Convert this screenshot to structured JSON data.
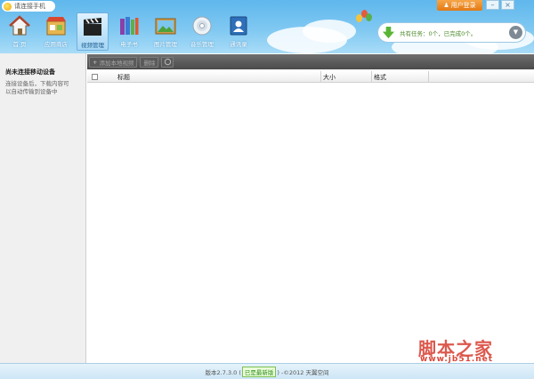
{
  "window": {
    "title": "请连接手机"
  },
  "header": {
    "login_label": "用户登录",
    "win_min": "–",
    "win_close": "×"
  },
  "nav": {
    "items": [
      {
        "label": "首 页",
        "icon": "home-icon"
      },
      {
        "label": "应用商店",
        "icon": "app-store-icon"
      },
      {
        "label": "视频管理",
        "icon": "video-clapper-icon",
        "active": true
      },
      {
        "label": "电子书",
        "icon": "books-icon"
      },
      {
        "label": "图片管理",
        "icon": "picture-icon"
      },
      {
        "label": "音乐管理",
        "icon": "cd-icon"
      },
      {
        "label": "通讯录",
        "icon": "contacts-icon"
      }
    ]
  },
  "task": {
    "text": "共有任务：0个，已完成0个。"
  },
  "left_panel": {
    "heading": "尚未连接移动设备",
    "desc_line1": "连接设备后，下载内容可",
    "desc_line2": "以自动传输到设备中"
  },
  "toolbar": {
    "add_label": "添加本地视频",
    "delete_label": "删除"
  },
  "table": {
    "columns": [
      "标题",
      "大小",
      "格式"
    ]
  },
  "footer": {
    "version_prefix": "版本2.7.3.0 (",
    "latest": "已是最新版",
    "suffix": ") -©2012 天翼空间"
  },
  "watermark": {
    "text": "脚本之家",
    "url": "www.jb51.net"
  }
}
